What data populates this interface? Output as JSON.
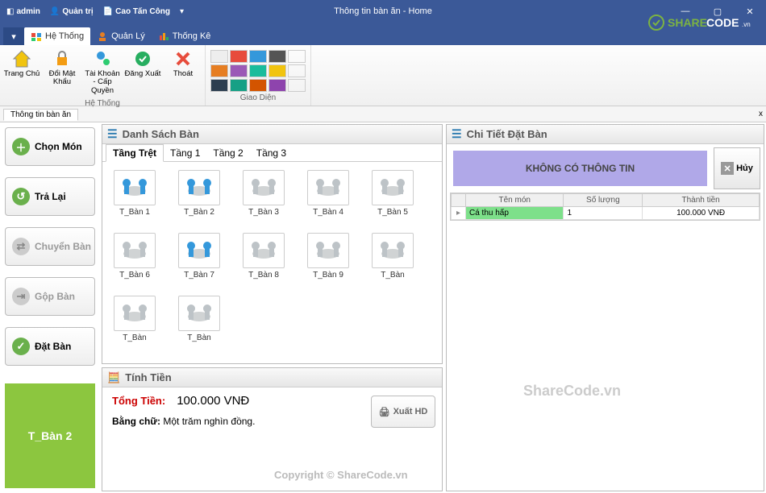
{
  "titlebar": {
    "items": [
      "admin",
      "Quản trị",
      "Cao Tấn Công"
    ],
    "app_title": "Thông tin bàn ăn - Home",
    "brand": "SHARECODE.vn"
  },
  "menutabs": {
    "tabs": [
      {
        "label": "Hệ Thống",
        "active": true
      },
      {
        "label": "Quản Lý",
        "active": false
      },
      {
        "label": "Thống Kê",
        "active": false
      }
    ]
  },
  "ribbon": {
    "group1_label": "Hệ Thống",
    "group2_label": "Giao Diện",
    "buttons": [
      {
        "label": "Trang Chủ"
      },
      {
        "label": "Đổi Mật Khẩu"
      },
      {
        "label": "Tài Khoản - Cấp Quyền"
      },
      {
        "label": "Đăng Xuất"
      },
      {
        "label": "Thoát"
      }
    ]
  },
  "doc_tab": "Thông tin bàn ăn",
  "left_actions": [
    {
      "label": "Chọn Món",
      "icon": "plus",
      "color": "#6ab04c"
    },
    {
      "label": "Trả Lại",
      "icon": "undo",
      "color": "#6ab04c"
    },
    {
      "label": "Chuyển Bàn",
      "icon": "swap",
      "color": "#bbb",
      "dim": true
    },
    {
      "label": "Gộp Bàn",
      "icon": "merge",
      "color": "#bbb",
      "dim": true
    },
    {
      "label": "Đặt Bàn",
      "icon": "check",
      "color": "#6ab04c"
    }
  ],
  "selected_table_label": "T_Bàn 2",
  "tables_panel_title": "Danh Sách Bàn",
  "floor_tabs": [
    "Tầng Trệt",
    "Tầng 1",
    "Tầng 2",
    "Tầng 3"
  ],
  "tables": [
    {
      "name": "T_Bàn 1",
      "occupied": true
    },
    {
      "name": "T_Bàn 2",
      "occupied": true
    },
    {
      "name": "T_Bàn 3",
      "occupied": false
    },
    {
      "name": "T_Bàn 4",
      "occupied": false
    },
    {
      "name": "T_Bàn 5",
      "occupied": false
    },
    {
      "name": "T_Bàn 6",
      "occupied": false
    },
    {
      "name": "T_Bàn 7",
      "occupied": true
    },
    {
      "name": "T_Bàn 8",
      "occupied": false
    },
    {
      "name": "T_Bàn 9",
      "occupied": false
    },
    {
      "name": "T_Bàn",
      "occupied": false
    },
    {
      "name": "T_Bàn",
      "occupied": false
    },
    {
      "name": "T_Bàn",
      "occupied": false
    }
  ],
  "calc_panel_title": "Tính Tiền",
  "total_label": "Tổng Tiền:",
  "total_value": "100.000 VNĐ",
  "total_text_label": "Bằng chữ:",
  "total_text_value": "Một trăm nghìn đồng.",
  "export_label": "Xuất HD",
  "detail_panel_title": "Chi Tiết Đặt Bàn",
  "no_info_label": "KHÔNG CÓ THÔNG TIN",
  "cancel_label": "Hủy",
  "detail_cols": [
    "",
    "Tên món",
    "Số lượng",
    "Thành tiền"
  ],
  "detail_rows": [
    {
      "name": "Cá thu hấp",
      "qty": "1",
      "price": "100.000 VNĐ"
    }
  ],
  "watermarks": {
    "a": "ShareCode.vn",
    "b": "Copyright © ShareCode.vn"
  }
}
